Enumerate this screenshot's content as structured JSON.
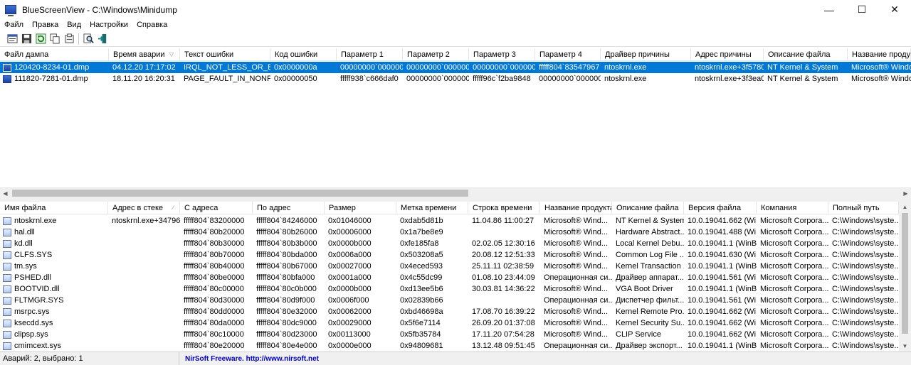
{
  "window": {
    "title": "BlueScreenView  -  C:\\Windows\\Minidump",
    "controls": {
      "minimize": "—",
      "maximize": "☐",
      "close": "✕"
    }
  },
  "menu": [
    "Файл",
    "Правка",
    "Вид",
    "Настройки",
    "Справка"
  ],
  "toolbar": [
    "properties-icon",
    "save-icon",
    "refresh-icon",
    "copy-icon",
    "options-icon",
    "find-icon",
    "exit-icon"
  ],
  "crashes": {
    "columns": [
      "Файл дампа",
      "Время аварии",
      "Текст ошибки",
      "Код ошибки",
      "Параметр 1",
      "Параметр 2",
      "Параметр 3",
      "Параметр 4",
      "Драйвер причины",
      "Адрес причины",
      "Описание файла",
      "Название продукта"
    ],
    "sorted_column": "Время аварии",
    "rows": [
      [
        "120420-8234-01.dmp",
        "04.12.20 17:17:02",
        "IRQL_NOT_LESS_OR_EQ...",
        "0x0000000a",
        "00000000`000000...",
        "00000000`000000...",
        "00000000`000000...",
        "fffff804`83547967",
        "ntoskrnl.exe",
        "ntoskrnl.exe+3f5780",
        "NT Kernel & System",
        "Microsoft® Windo..."
      ],
      [
        "111820-7281-01.dmp",
        "18.11.20 16:20:31",
        "PAGE_FAULT_IN_NONPA...",
        "0x00000050",
        "fffff938`c666daf0",
        "00000000`000000...",
        "fffff96c`f2ba9848",
        "00000000`000000...",
        "ntoskrnl.exe",
        "ntoskrnl.exe+3f3ea0",
        "NT Kernel & System",
        "Microsoft® Windo..."
      ]
    ],
    "selected_row": 0
  },
  "drivers": {
    "columns": [
      "Имя файла",
      "Адрес в стеке",
      "С адреса",
      "По адрес",
      "Размер",
      "Метка времени",
      "Строка времени",
      "Название продукта",
      "Описание файла",
      "Версия файла",
      "Компания",
      "Полный путь"
    ],
    "sorted_column": "Адрес в стеке",
    "rows": [
      [
        "ntoskrnl.exe",
        "ntoskrnl.exe+347967",
        "fffff804`83200000",
        "fffff804`84246000",
        "0x01046000",
        "0xdab5d81b",
        "11.04.86 11:00:27",
        "Microsoft® Wind...",
        "NT Kernel & System",
        "10.0.19041.662 (Wi...",
        "Microsoft Corpora...",
        "C:\\Windows\\syste..."
      ],
      [
        "hal.dll",
        "",
        "fffff804`80b20000",
        "fffff804`80b26000",
        "0x00006000",
        "0x1a7be8e9",
        "",
        "Microsoft® Wind...",
        "Hardware Abstract...",
        "10.0.19041.488 (Wi...",
        "Microsoft Corpora...",
        "C:\\Windows\\syste..."
      ],
      [
        "kd.dll",
        "",
        "fffff804`80b30000",
        "fffff804`80b3b000",
        "0x0000b000",
        "0xfe185fa8",
        "02.02.05 12:30:16",
        "Microsoft® Wind...",
        "Local Kernel Debu...",
        "10.0.19041.1 (WinB...",
        "Microsoft Corpora...",
        "C:\\Windows\\syste..."
      ],
      [
        "CLFS.SYS",
        "",
        "fffff804`80b70000",
        "fffff804`80bda000",
        "0x0006a000",
        "0x503208a5",
        "20.08.12 12:51:33",
        "Microsoft® Wind...",
        "Common Log File ...",
        "10.0.19041.630 (Wi...",
        "Microsoft Corpora...",
        "C:\\Windows\\syste..."
      ],
      [
        "tm.sys",
        "",
        "fffff804`80b40000",
        "fffff804`80b67000",
        "0x00027000",
        "0x4eced593",
        "25.11.11 02:38:59",
        "Microsoft® Wind...",
        "Kernel Transaction ...",
        "10.0.19041.1 (WinB...",
        "Microsoft Corpora...",
        "C:\\Windows\\syste..."
      ],
      [
        "PSHED.dll",
        "",
        "fffff804`80be0000",
        "fffff804`80bfa000",
        "0x0001a000",
        "0x4c55dc99",
        "01.08.10 23:44:09",
        "Операционная си...",
        "Драйвер аппарат...",
        "10.0.19041.561 (Wi...",
        "Microsoft Corpora...",
        "C:\\Windows\\syste..."
      ],
      [
        "BOOTVID.dll",
        "",
        "fffff804`80c00000",
        "fffff804`80c0b000",
        "0x0000b000",
        "0xd13ee5b6",
        "30.03.81 14:36:22",
        "Microsoft® Wind...",
        "VGA Boot Driver",
        "10.0.19041.1 (WinB...",
        "Microsoft Corpora...",
        "C:\\Windows\\syste..."
      ],
      [
        "FLTMGR.SYS",
        "",
        "fffff804`80d30000",
        "fffff804`80d9f000",
        "0x0006f000",
        "0x02839b66",
        "",
        "Операционная си...",
        "Диспетчер фильт...",
        "10.0.19041.561 (Wi...",
        "Microsoft Corpora...",
        "C:\\Windows\\syste..."
      ],
      [
        "msrpc.sys",
        "",
        "fffff804`80dd0000",
        "fffff804`80e32000",
        "0x00062000",
        "0xbd46698a",
        "17.08.70 16:39:22",
        "Microsoft® Wind...",
        "Kernel Remote Pro...",
        "10.0.19041.662 (Wi...",
        "Microsoft Corpora...",
        "C:\\Windows\\syste..."
      ],
      [
        "ksecdd.sys",
        "",
        "fffff804`80da0000",
        "fffff804`80dc9000",
        "0x00029000",
        "0x5f6e7114",
        "26.09.20 01:37:08",
        "Microsoft® Wind...",
        "Kernel Security Su...",
        "10.0.19041.662 (Wi...",
        "Microsoft Corpora...",
        "C:\\Windows\\syste..."
      ],
      [
        "clipsp.sys",
        "",
        "fffff804`80c10000",
        "fffff804`80d23000",
        "0x00113000",
        "0x5fb35784",
        "17.11.20 07:54:28",
        "Microsoft® Wind...",
        "CLIP Service",
        "10.0.19041.662 (Wi...",
        "Microsoft Corpora...",
        "C:\\Windows\\syste..."
      ],
      [
        "cmimcext.sys",
        "",
        "fffff804`80e20000",
        "fffff804`80e4e000",
        "0x0000e000",
        "0x94809681",
        "13.12.48 09:51:45",
        "Операционная си...",
        "Драйвер экспорт...",
        "10.0.19041.1 (WinB...",
        "Microsoft Corpora...",
        "C:\\Windows\\syste..."
      ]
    ]
  },
  "status": {
    "summary": "Аварий: 2, выбрано: 1",
    "link": "NirSoft Freeware.  http://www.nirsoft.net"
  },
  "colors": {
    "selection": "#0078d7",
    "link": "#0000cc"
  }
}
